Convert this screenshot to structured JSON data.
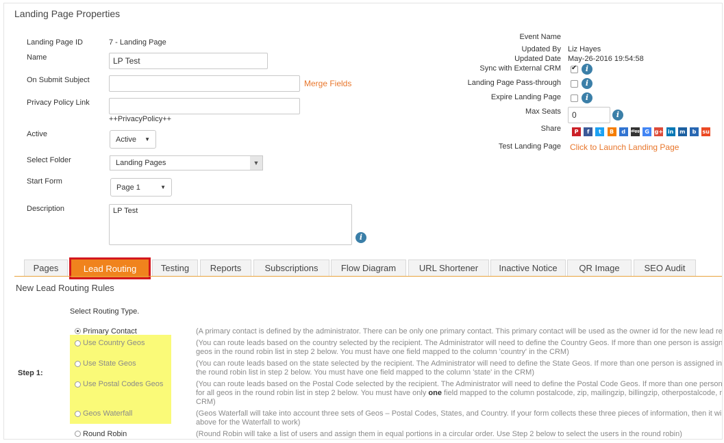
{
  "page": {
    "title": "Landing Page Properties"
  },
  "left_form": {
    "id_label": "Landing Page ID",
    "id_value": "7   - Landing Page",
    "name_label": "Name",
    "name_value": "LP Test",
    "subject_label": "On Submit Subject",
    "subject_value": "",
    "merge_fields": "Merge Fields",
    "privacy_label": "Privacy Policy Link",
    "privacy_value": "",
    "privacy_hint": "++PrivacyPolicy++",
    "active_label": "Active",
    "active_value": "Active",
    "folder_label": "Select Folder",
    "folder_value": "Landing Pages",
    "start_form_label": "Start Form",
    "start_form_value": "Page 1",
    "description_label": "Description",
    "description_value": "LP Test"
  },
  "right_panel": {
    "event_name_label": "Event Name",
    "updated_by_label": "Updated By",
    "updated_by_value": "Liz Hayes",
    "updated_date_label": "Updated Date",
    "updated_date_value": "May-26-2016 19:54:58",
    "sync_label": "Sync with External CRM",
    "sync_checked": true,
    "passthrough_label": "Landing Page Pass-through",
    "passthrough_checked": false,
    "expire_label": "Expire Landing Page",
    "expire_checked": false,
    "max_seats_label": "Max Seats",
    "max_seats_value": "0",
    "share_label": "Share",
    "test_label": "Test Landing Page",
    "test_link": "Click to Launch Landing Page"
  },
  "share_icons": [
    {
      "name": "pinterest-icon",
      "glyph": "P",
      "color": "#cb2027"
    },
    {
      "name": "facebook-icon",
      "glyph": "f",
      "color": "#3b5998"
    },
    {
      "name": "twitter-icon",
      "glyph": "t",
      "color": "#1da1f2"
    },
    {
      "name": "blogger-icon",
      "glyph": "B",
      "color": "#f57d00"
    },
    {
      "name": "delicious-icon",
      "glyph": "d",
      "color": "#3274d1"
    },
    {
      "name": "digg-icon",
      "glyph": "digg",
      "color": "#333333"
    },
    {
      "name": "google-icon",
      "glyph": "G",
      "color": "#4285f4"
    },
    {
      "name": "googleplus-icon",
      "glyph": "g+",
      "color": "#dd4b39"
    },
    {
      "name": "linkedin-icon",
      "glyph": "in",
      "color": "#0077b5"
    },
    {
      "name": "myspace-icon",
      "glyph": "m",
      "color": "#1b5fa0"
    },
    {
      "name": "bookmark-icon",
      "glyph": "b",
      "color": "#2867b2"
    },
    {
      "name": "stumbleupon-icon",
      "glyph": "su",
      "color": "#eb4924"
    }
  ],
  "tabs": [
    "Pages",
    "Lead Routing",
    "Testing",
    "Reports",
    "Subscriptions",
    "Flow Diagram",
    "URL Shortener",
    "Inactive Notice",
    "QR Image",
    "SEO Audit"
  ],
  "routing": {
    "section_title": "New Lead Routing Rules",
    "select_type_label": "Select Routing Type.",
    "step_label": "Step 1:",
    "options": {
      "primary": "Primary Contact",
      "country": "Use Country Geos",
      "state": "Use State Geos",
      "postal": "Use Postal Codes Geos",
      "waterfall": "Geos Waterfall",
      "round_robin": "Round Robin"
    },
    "desc": {
      "primary": "(A primary contact is defined by the administrator. There can be only one primary contact. This primary contact will be used as the owner id for the new lead reco",
      "country_1": "(You can route leads based on the country selected by the recipient. The Administrator will need to define the Country Geos. If more than one person is assigned i",
      "country_2": "geos in the round robin list in step 2 below. You must have one field mapped to the column 'country' in the CRM)",
      "state_1": "(You can route leads based on the state selected by the recipient. The Administrator will need to define the State Geos. If more than one person is assigned in the",
      "state_2": "the round robin list in step 2 below. You must have one field mapped to the column 'state' in the CRM)",
      "postal_1": "(You can route leads based on the Postal Code selected by the recipient. The Administrator will need to define the Postal Code Geos. If more than one person is a",
      "postal_2a": "for all geos in the round robin list in step 2 below. You must have only ",
      "postal_2b": "one",
      "postal_2c": " field mapped to the column postalcode, zip, mailingzip, billingzip, otherpostalcode, mail",
      "postal_3": "CRM)",
      "waterfall_1": "(Geos Waterfall will take into account three sets of Geos – Postal Codes, States, and Country. If your form collects these three pieces of information, then it will fi",
      "waterfall_2": "above for the Waterfall to work)",
      "round_robin": "(Round Robin will take a list of users and assign them in equal portions in a circular order. Use Step 2 below to select the users in the round robin)"
    }
  }
}
